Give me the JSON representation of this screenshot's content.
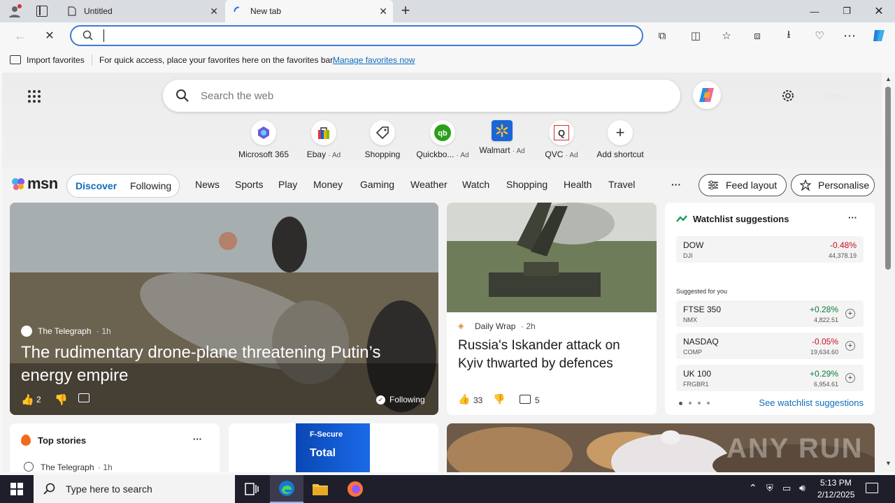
{
  "browser": {
    "tabs": [
      {
        "title": "Untitled",
        "icon": "page-icon"
      },
      {
        "title": "New tab",
        "icon": "loading-spinner-icon"
      }
    ],
    "address": {
      "value": ""
    },
    "favorites_bar": {
      "import_label": "Import favorites",
      "hint_text": "For quick access, place your favorites here on the favorites bar.",
      "manage_link": "Manage favorites now"
    }
  },
  "msn": {
    "search_placeholder": "Search the web",
    "sign_in": "Sign in",
    "shortcuts": [
      {
        "label": "Microsoft 365",
        "ad": ""
      },
      {
        "label": "Ebay",
        "ad": "· Ad"
      },
      {
        "label": "Shopping",
        "ad": ""
      },
      {
        "label": "Quickbo...",
        "ad": "· Ad"
      },
      {
        "label": "Walmart",
        "ad": "· Ad"
      },
      {
        "label": "QVC",
        "ad": "· Ad"
      },
      {
        "label": "Add shortcut",
        "ad": ""
      }
    ],
    "logo": "msn",
    "feed_toggle": {
      "discover": "Discover",
      "following": "Following"
    },
    "nav": [
      "News",
      "Sports",
      "Play",
      "Money",
      "Gaming",
      "Weather",
      "Watch",
      "Shopping",
      "Health",
      "Travel"
    ],
    "more": "···",
    "feed_layout": "Feed layout",
    "personalise": "Personalise",
    "hero_story": {
      "source": "The Telegraph",
      "age": "· 1h",
      "headline": "The rudimentary drone-plane threatening Putin’s energy empire",
      "likes": "2",
      "following_label": "Following"
    },
    "story2": {
      "source": "Daily Wrap",
      "age": "· 2h",
      "headline": "Russia's Iskander attack on Kyiv thwarted by defences",
      "likes": "33",
      "comments": "5"
    },
    "watchlist": {
      "title": "Watchlist suggestions",
      "more": "···",
      "dow": {
        "name": "DOW",
        "code": "DJI",
        "change": "-0.48%",
        "value": "44,378.19"
      },
      "suggested_label": "Suggested for you",
      "suggestions": [
        {
          "name": "FTSE 350",
          "code": "NMX",
          "change": "+0.28%",
          "value": "4,822.51"
        },
        {
          "name": "NASDAQ",
          "code": "COMP",
          "change": "-0.05%",
          "value": "19,634.60"
        },
        {
          "name": "UK 100",
          "code": "FRGBR1",
          "change": "+0.29%",
          "value": "6,954.61"
        }
      ],
      "see_link": "See watchlist suggestions"
    },
    "top_stories": {
      "title": "Top stories",
      "more": "···",
      "source": "The Telegraph",
      "age": "· 1h"
    },
    "ad_card": {
      "brand": "F-Secure",
      "product": "Total"
    },
    "watermark": "ANY RUN"
  },
  "taskbar": {
    "search_placeholder": "Type here to search",
    "time": "5:13 PM",
    "date": "2/12/2025"
  },
  "colors": {
    "accent": "#0f6cbd",
    "positive": "#0b7a3a",
    "negative": "#c50f1f",
    "taskbar": "#1f1f2c"
  }
}
